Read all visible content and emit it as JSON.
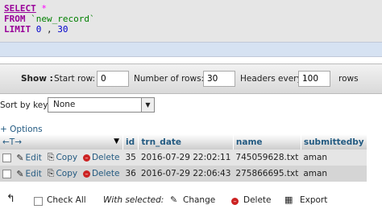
{
  "sql": {
    "select_kw": "SELECT",
    "select_star": "*",
    "from_kw": "FROM",
    "table_name": "`new_record`",
    "limit_kw": "LIMIT",
    "limit_offset": "0",
    "limit_comma": ",",
    "limit_count": "30"
  },
  "nav": {
    "show_label": "Show :",
    "start_row_label": "Start row:",
    "start_row_value": "0",
    "num_rows_label": "Number of rows:",
    "num_rows_value": "30",
    "headers_every_label": "Headers every",
    "headers_every_value": "100",
    "rows_label": "rows"
  },
  "sort": {
    "label": "Sort by key:",
    "selected": "None"
  },
  "options_link": "+ Options",
  "table": {
    "header_arrows": "←T→",
    "headers": [
      "id",
      "trn_date",
      "name",
      "submittedby"
    ],
    "edit_label": "Edit",
    "copy_label": "Copy",
    "delete_label": "Delete",
    "rows": [
      {
        "id": "35",
        "trn_date": "2016-07-29 22:02:11",
        "name": "745059628.txt",
        "submittedby": "aman"
      },
      {
        "id": "36",
        "trn_date": "2016-07-29 22:06:43",
        "name": "275866695.txt",
        "submittedby": "aman"
      }
    ]
  },
  "bottom": {
    "check_all": "Check All",
    "with_selected": "With selected:",
    "change": "Change",
    "delete": "Delete",
    "export": "Export"
  }
}
